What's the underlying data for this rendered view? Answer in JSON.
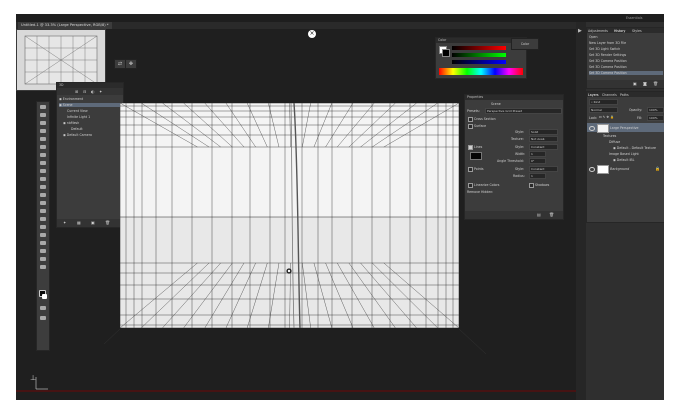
{
  "document": {
    "tab_title": "Untitled-1 @ 33.3% (Large Perspective, RGB/8) *",
    "close_glyph": "×"
  },
  "panel_3d": {
    "tabs_label": "3D",
    "items": [
      {
        "label": "Environment",
        "selected": false
      },
      {
        "label": "Scene",
        "selected": true
      },
      {
        "label": "Current View",
        "selected": false
      },
      {
        "label": "Infinite Light 1",
        "selected": false
      },
      {
        "label": "nbMesh",
        "selected": false
      },
      {
        "label": "Default",
        "selected": false
      },
      {
        "label": "Default Camera",
        "selected": false
      }
    ]
  },
  "color_panel": {
    "tab_label": "Color",
    "color_button": "Color"
  },
  "properties_panel": {
    "tab_label": "Properties",
    "header": "Scene",
    "presets_label": "Presets:",
    "presets_value": "Perspective Grid Preset",
    "cross_section": "Cross Section",
    "surface": "Surface",
    "style_label": "Style:",
    "style_value": "Solid",
    "texture_label": "Texture:",
    "texture_value": "Not Avail.",
    "lines": "Lines",
    "lines_style_value": "Constant",
    "width_label": "Width:",
    "width_value": "1",
    "angle_label": "Angle Threshold:",
    "angle_value": "0°",
    "points": "Points",
    "points_style_value": "Constant",
    "radius_label": "Radius:",
    "radius_value": "1",
    "linearize": "Linearize Colors",
    "shadows": "Shadows",
    "remove_hidden": "Remove Hidden:"
  },
  "history_panel": {
    "tabs": [
      "Adjustments",
      "History",
      "Styles"
    ],
    "items": [
      {
        "label": "Open"
      },
      {
        "label": "New Layer from 3D File"
      },
      {
        "label": "Set 3D Light Switch"
      },
      {
        "label": "Set 3D Render Settings"
      },
      {
        "label": "Set 3D Camera Position"
      },
      {
        "label": "Set 3D Camera Position"
      },
      {
        "label": "Set 3D Camera Position"
      }
    ]
  },
  "layers_panel": {
    "tabs": [
      "Layers",
      "Channels",
      "Paths"
    ],
    "kind_label": "Kind",
    "blend_mode": "Normal",
    "opacity_label": "Opacity:",
    "opacity_value": "100%",
    "lock_label": "Lock:",
    "fill_label": "Fill:",
    "fill_value": "100%",
    "layers": [
      {
        "name": "Large Perspective"
      },
      {
        "name": "Textures"
      },
      {
        "name": "Diffuse"
      },
      {
        "name": "Default - Default Texture"
      },
      {
        "name": "Image Based Light"
      },
      {
        "name": "Default IBL"
      },
      {
        "name": "Background"
      }
    ]
  },
  "menubar": {
    "workspace": "Essentials"
  },
  "status": {
    "axis_glyph": "⊥"
  },
  "colors": {
    "app_bg": "#535353",
    "canvas_dark": "#1f1f1f",
    "panel": "#3c3c3c",
    "selection": "#5e6a7a",
    "accent_red": "#b00000"
  }
}
